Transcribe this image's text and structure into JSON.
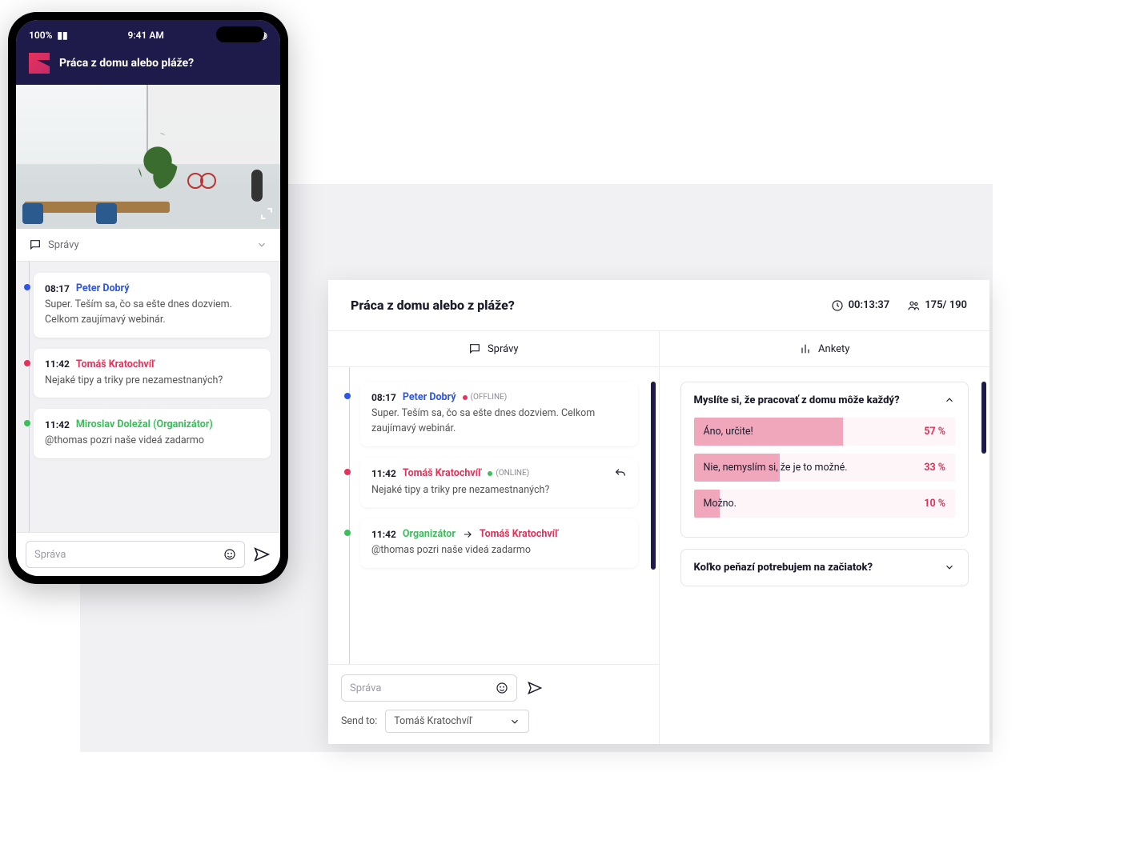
{
  "phone": {
    "statusbar": {
      "battery": "100%",
      "time": "9:41 AM"
    },
    "title": "Práca z domu alebo pláže?",
    "section_label": "Správy",
    "messages": [
      {
        "dot": "blue",
        "time": "08:17",
        "name": "Peter Dobrý",
        "name_cls": "name-blue",
        "body": "Super. Teším sa, čo sa ešte dnes dozviem. Celkom zaujímavý webinár."
      },
      {
        "dot": "red",
        "time": "11:42",
        "name": "Tomáš Kratochvíľ",
        "name_cls": "name-red",
        "body": "Nejaké tipy a triky pre nezamestnaných?"
      },
      {
        "dot": "green",
        "time": "11:42",
        "name": "Miroslav Doležal (Organizátor)",
        "name_cls": "name-green",
        "body": "@thomas pozri naše videá zadarmo"
      }
    ],
    "compose_placeholder": "Správa"
  },
  "desktop": {
    "title": "Práca z domu alebo z pláže?",
    "timer": "00:13:37",
    "attendance": "175/ 190",
    "tabs": {
      "messages": "Správy",
      "polls": "Ankety"
    },
    "messages": [
      {
        "dot": "blue",
        "time": "08:17",
        "name": "Peter Dobrý",
        "name_cls": "name-blue",
        "status": "(OFFLINE)",
        "status_cls": "sd-off",
        "body": "Super. Teším sa, čo sa ešte dnes dozviem. Celkom zaujímavý webinár."
      },
      {
        "dot": "red",
        "time": "11:42",
        "name": "Tomáš Kratochvíľ",
        "name_cls": "name-red",
        "status": "(ONLINE)",
        "status_cls": "sd-on",
        "reply": true,
        "body": "Nejaké tipy a triky pre nezamestnaných?"
      },
      {
        "dot": "green",
        "time": "11:42",
        "name": "Organizátor",
        "name_cls": "name-green",
        "to_name": "Tomáš Kratochvíľ",
        "body": "@thomas pozri naše videá zadarmo"
      }
    ],
    "compose_placeholder": "Správa",
    "send_to_label": "Send to:",
    "send_to_value": "Tomáš Kratochvíľ",
    "polls": [
      {
        "question": "Myslíte si, že pracovať z domu môže každý?",
        "expanded": true,
        "options": [
          {
            "label": "Áno, určite!",
            "pct": 57
          },
          {
            "label": "Nie, nemyslím si, že je to možné.",
            "pct": 33
          },
          {
            "label": "Možno.",
            "pct": 10
          }
        ]
      },
      {
        "question": "Koľko peňazí potrebujem na začiatok?",
        "expanded": false
      }
    ]
  }
}
